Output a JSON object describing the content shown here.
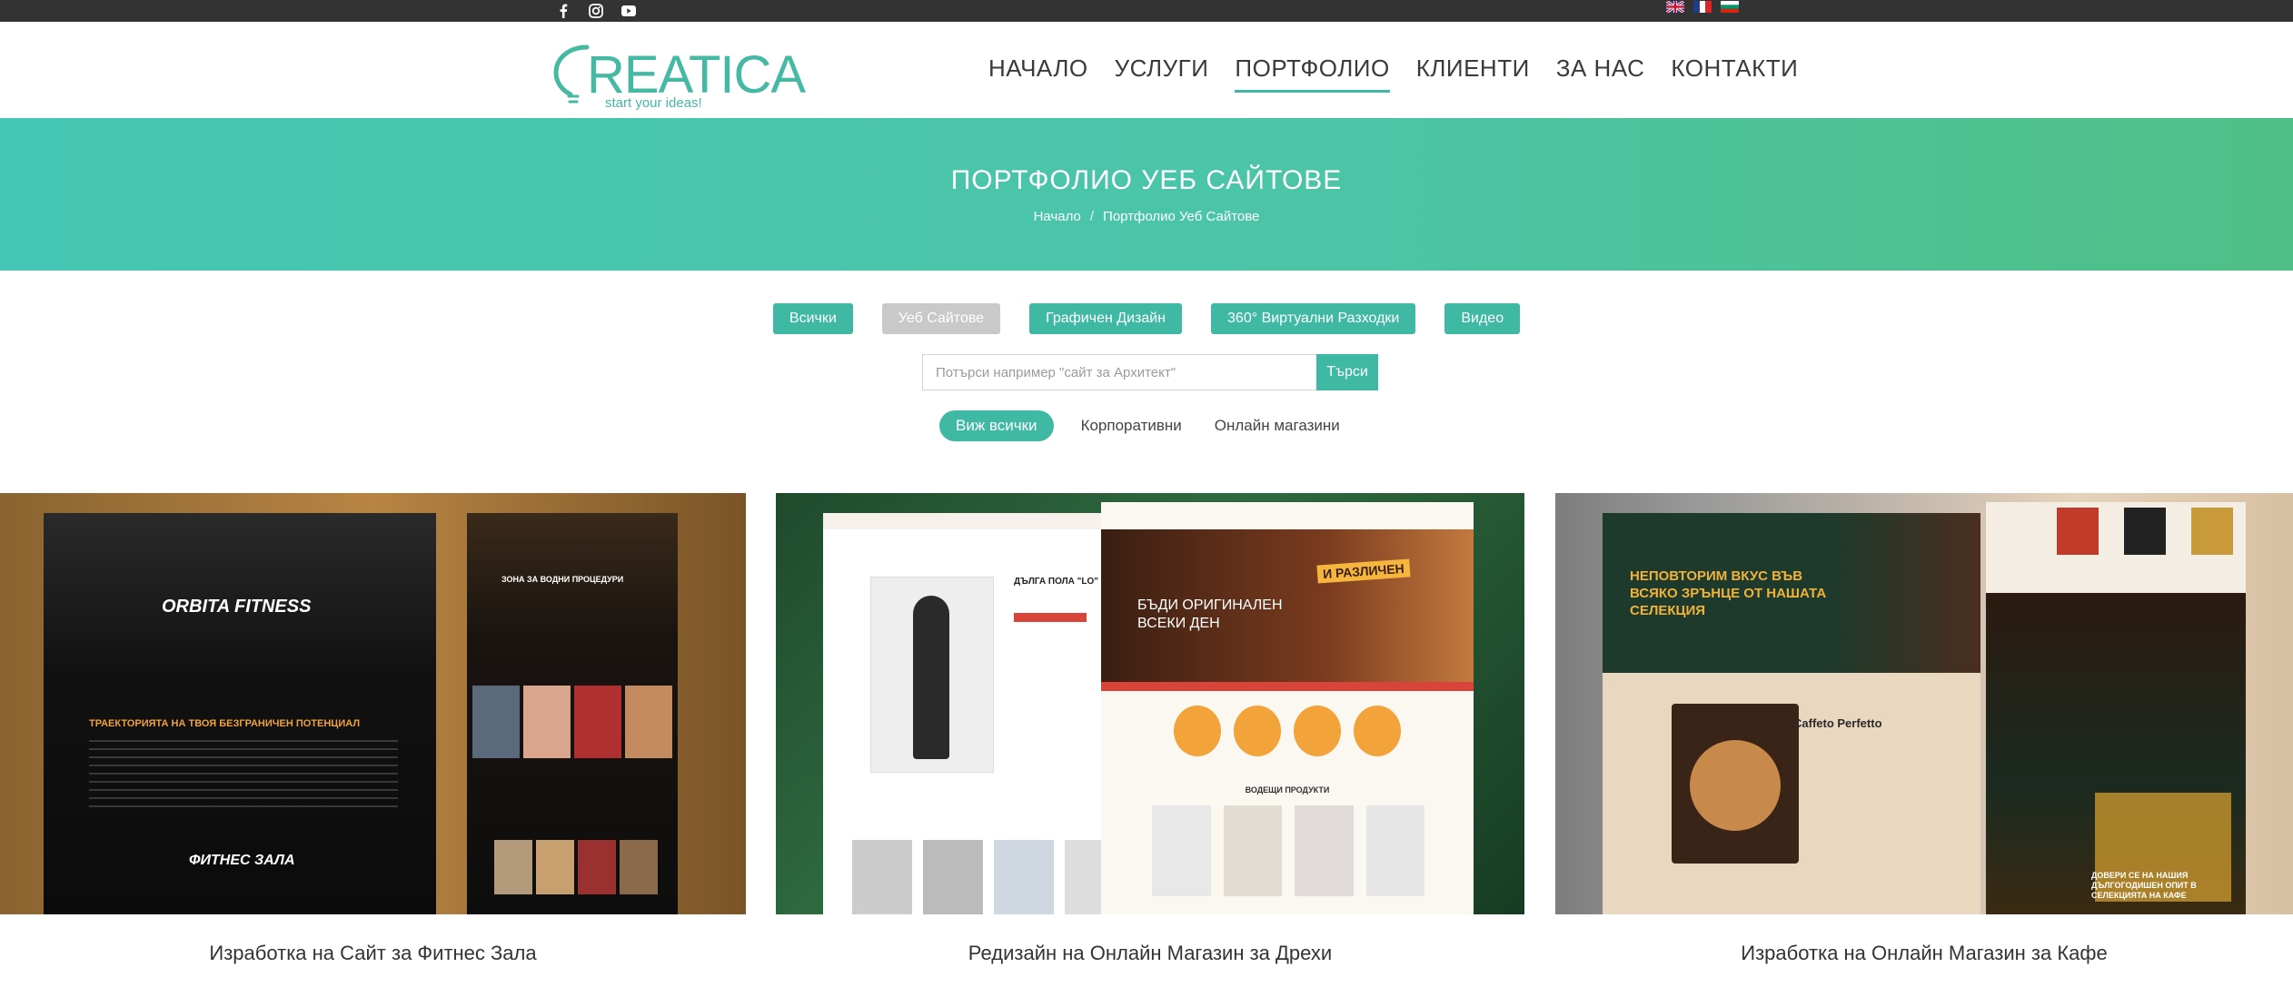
{
  "topbar": {
    "social": [
      "facebook-icon",
      "instagram-icon",
      "youtube-icon"
    ],
    "languages": [
      "flag-uk",
      "flag-fr",
      "flag-bg"
    ]
  },
  "logo": {
    "name": "CREATICA",
    "tagline": "start your ideas!"
  },
  "nav": [
    {
      "label": "НАЧАЛО"
    },
    {
      "label": "УСЛУГИ"
    },
    {
      "label": "ПОРТФОЛИО",
      "active": true
    },
    {
      "label": "КЛИЕНТИ"
    },
    {
      "label": "ЗА НАС"
    },
    {
      "label": "КОНТАКТИ"
    }
  ],
  "hero": {
    "title": "ПОРТФОЛИО УЕБ САЙТОВЕ",
    "breadcrumb_home": "Начало",
    "breadcrumb_sep": "/",
    "breadcrumb_current": "Портфолио Уеб Сайтове"
  },
  "filters": [
    {
      "label": "Всички"
    },
    {
      "label": "Уеб Сайтове",
      "active": true
    },
    {
      "label": "Графичен Дизайн"
    },
    {
      "label": "360° Виртуални Разходки"
    },
    {
      "label": "Видео"
    }
  ],
  "search": {
    "placeholder": "Потърси например \"сайт за Архитект\"",
    "button": "Търси"
  },
  "subfilters": [
    {
      "label": "Виж всички",
      "active": true
    },
    {
      "label": "Корпоративни"
    },
    {
      "label": "Онлайн магазини"
    }
  ],
  "portfolio": [
    {
      "caption": "Изработка на Сайт за Фитнес Зала",
      "thumb_title": "ORBITA FITNESS",
      "thumb_text1": "ТРАЕКТОРИЯТА НА ТВОЯ БЕЗГРАНИЧЕН ПОТЕНЦИАЛ",
      "thumb_text2": "ФИТНЕС ЗАЛА",
      "thumb_text3": "ЗОНА ЗА ВОДНИ ПРОЦЕДУРИ"
    },
    {
      "caption": "Редизайн на Онлайн Магазин за Дрехи",
      "thumb_text1": "БЪДИ ОРИГИНАЛЕН ВСЕКИ ДЕН",
      "thumb_text2": "И РАЗЛИЧЕН",
      "thumb_text3": "ВОДЕЩИ ПРОДУКТИ",
      "thumb_text4": "ДЪЛГА ПОЛА \"LO\""
    },
    {
      "caption": "Изработка на Онлайн Магазин за Кафе",
      "thumb_text1": "НЕПОВТОРИМ ВКУС ВЪВ ВСЯКО ЗРЪНЦЕ ОТ НАШАТА СЕЛЕКЦИЯ",
      "thumb_text2": "Caffeto Perfetto",
      "thumb_text3": "ДОВЕРИ СЕ НА НАШИЯ ДЪЛГОГОДИШЕН ОПИТ В СЕЛЕКЦИЯТА НА КАФЕ"
    }
  ],
  "colors": {
    "accent": "#3fb8a4",
    "topbar": "#333333",
    "hero_start": "#46c6b4",
    "hero_end": "#4fbf86"
  }
}
